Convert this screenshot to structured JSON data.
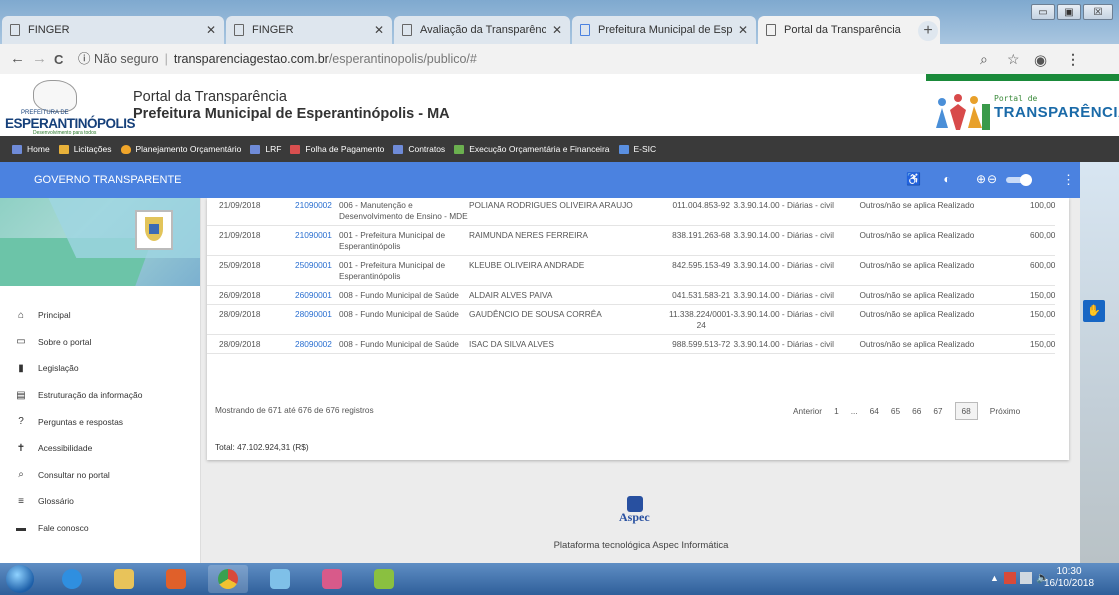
{
  "browser": {
    "tabs": [
      {
        "label": "FINGER",
        "active": false
      },
      {
        "label": "FINGER",
        "active": false
      },
      {
        "label": "Avaliação da Transparência do",
        "active": false
      },
      {
        "label": "Prefeitura Municipal de Espera",
        "active": false
      },
      {
        "label": "Portal da Transparência",
        "active": true
      }
    ],
    "new_tab": "+",
    "window_controls": {
      "minimize": "▭",
      "maximize": "▣",
      "close": "☒"
    },
    "nav": {
      "back": "←",
      "forward": "→",
      "reload": "C",
      "info": "ⓘ"
    },
    "address": {
      "security": "Não seguro",
      "host": "transparenciagestao.com.br",
      "path": "/esperantinopolis/publico/#"
    },
    "toolbar": {
      "zoom_icon": "magnifier-icon",
      "star_icon": "star-icon",
      "profile_icon": "profile-icon",
      "menu_icon": "⋮"
    }
  },
  "header": {
    "logo": {
      "name": "ESPERANTINÓPOLIS",
      "prefix": "PREFEITURA DE",
      "tagline": "Desenvolvimento para todos"
    },
    "title": "Portal da Transparência",
    "subtitle": "Prefeitura Municipal de Esperantinópolis - MA",
    "brand_small": "Portal de",
    "brand_big": "TRANSPARÊNCIA"
  },
  "nav": {
    "items": [
      {
        "label": "Home",
        "icon": "home-icon",
        "color": "#6f8bd8"
      },
      {
        "label": "Licitações",
        "icon": "gavel-icon",
        "color": "#e8b13a"
      },
      {
        "label": "Planejamento Orçamentário",
        "icon": "flame-icon",
        "color": "#f0a52a"
      },
      {
        "label": "LRF",
        "icon": "chart-icon",
        "color": "#6f8bd8"
      },
      {
        "label": "Folha de Pagamento",
        "icon": "payroll-icon",
        "color": "#d94f4f"
      },
      {
        "label": "Contratos",
        "icon": "document-icon",
        "color": "#6f8bd8"
      },
      {
        "label": "Execução Orçamentária e Financeira",
        "icon": "plant-icon",
        "color": "#6bb04f"
      },
      {
        "label": "E-SIC",
        "icon": "esic-icon",
        "color": "#5a8fe0"
      }
    ]
  },
  "bluebar": {
    "label": "GOVERNO TRANSPARENTE",
    "color": "#4b82e0",
    "more": "⋮"
  },
  "sidebar": {
    "items": [
      {
        "label": "Principal",
        "icon": "home-icon",
        "glyph": "🏠"
      },
      {
        "label": "Sobre o portal",
        "icon": "folder-icon",
        "glyph": "▭"
      },
      {
        "label": "Legislação",
        "icon": "file-icon",
        "glyph": "▮"
      },
      {
        "label": "Estruturação da informação",
        "icon": "structure-icon",
        "glyph": "▤"
      },
      {
        "label": "Perguntas e respostas",
        "icon": "question-icon",
        "glyph": "?"
      },
      {
        "label": "Acessibilidade",
        "icon": "accessibility-icon",
        "glyph": "✝"
      },
      {
        "label": "Consultar no portal",
        "icon": "search-icon",
        "glyph": "⌕"
      },
      {
        "label": "Glossário",
        "icon": "list-icon",
        "glyph": "≡"
      },
      {
        "label": "Fale conosco",
        "icon": "message-icon",
        "glyph": "▬"
      }
    ]
  },
  "table": {
    "rows": [
      {
        "date": "21/09/2018",
        "num": "21090002",
        "org": "006 - Manutenção e Desenvolvimento de Ensino - MDE",
        "name": "POLIANA RODRIGUES OLIVEIRA ARAUJO",
        "doc": "011.004.853-92",
        "element": "3.3.90.14.00 - Diárias - civil",
        "mod": "Outros/não se aplica",
        "status": "Realizado",
        "value": "100,00"
      },
      {
        "date": "21/09/2018",
        "num": "21090001",
        "org": "001 - Prefeitura Municipal de Esperantinópolis",
        "name": "RAIMUNDA NERES FERREIRA",
        "doc": "838.191.263-68",
        "element": "3.3.90.14.00 - Diárias - civil",
        "mod": "Outros/não se aplica",
        "status": "Realizado",
        "value": "600,00"
      },
      {
        "date": "25/09/2018",
        "num": "25090001",
        "org": "001 - Prefeitura Municipal de Esperantinópolis",
        "name": "KLEUBE OLIVEIRA ANDRADE",
        "doc": "842.595.153-49",
        "element": "3.3.90.14.00 - Diárias - civil",
        "mod": "Outros/não se aplica",
        "status": "Realizado",
        "value": "600,00"
      },
      {
        "date": "26/09/2018",
        "num": "26090001",
        "org": "008 - Fundo Municipal de Saúde",
        "name": "ALDAIR ALVES PAIVA",
        "doc": "041.531.583-21",
        "element": "3.3.90.14.00 - Diárias - civil",
        "mod": "Outros/não se aplica",
        "status": "Realizado",
        "value": "150,00"
      },
      {
        "date": "28/09/2018",
        "num": "28090001",
        "org": "008 - Fundo Municipal de Saúde",
        "name": "GAUDÊNCIO DE SOUSA CORRÊA",
        "doc": "11.338.224/0001-24",
        "element": "3.3.90.14.00 - Diárias - civil",
        "mod": "Outros/não se aplica",
        "status": "Realizado",
        "value": "150,00"
      },
      {
        "date": "28/09/2018",
        "num": "28090002",
        "org": "008 - Fundo Municipal de Saúde",
        "name": "ISAC DA SILVA ALVES",
        "doc": "988.599.513-72",
        "element": "3.3.90.14.00 - Diárias - civil",
        "mod": "Outros/não se aplica",
        "status": "Realizado",
        "value": "150,00"
      }
    ],
    "showing": "Mostrando de 671 até 676 de 676 registros",
    "pager": {
      "prev": "Anterior",
      "pages": [
        "1",
        "...",
        "64",
        "65",
        "66",
        "67",
        "68"
      ],
      "current": "68",
      "next": "Próximo"
    },
    "total": "Total: 47.102.924,31 (R$)"
  },
  "footer": {
    "brand": "Aspec",
    "text": "Plataforma tecnológica Aspec Informática"
  },
  "taskbar": {
    "time": "10:30",
    "date": "16/10/2018"
  }
}
